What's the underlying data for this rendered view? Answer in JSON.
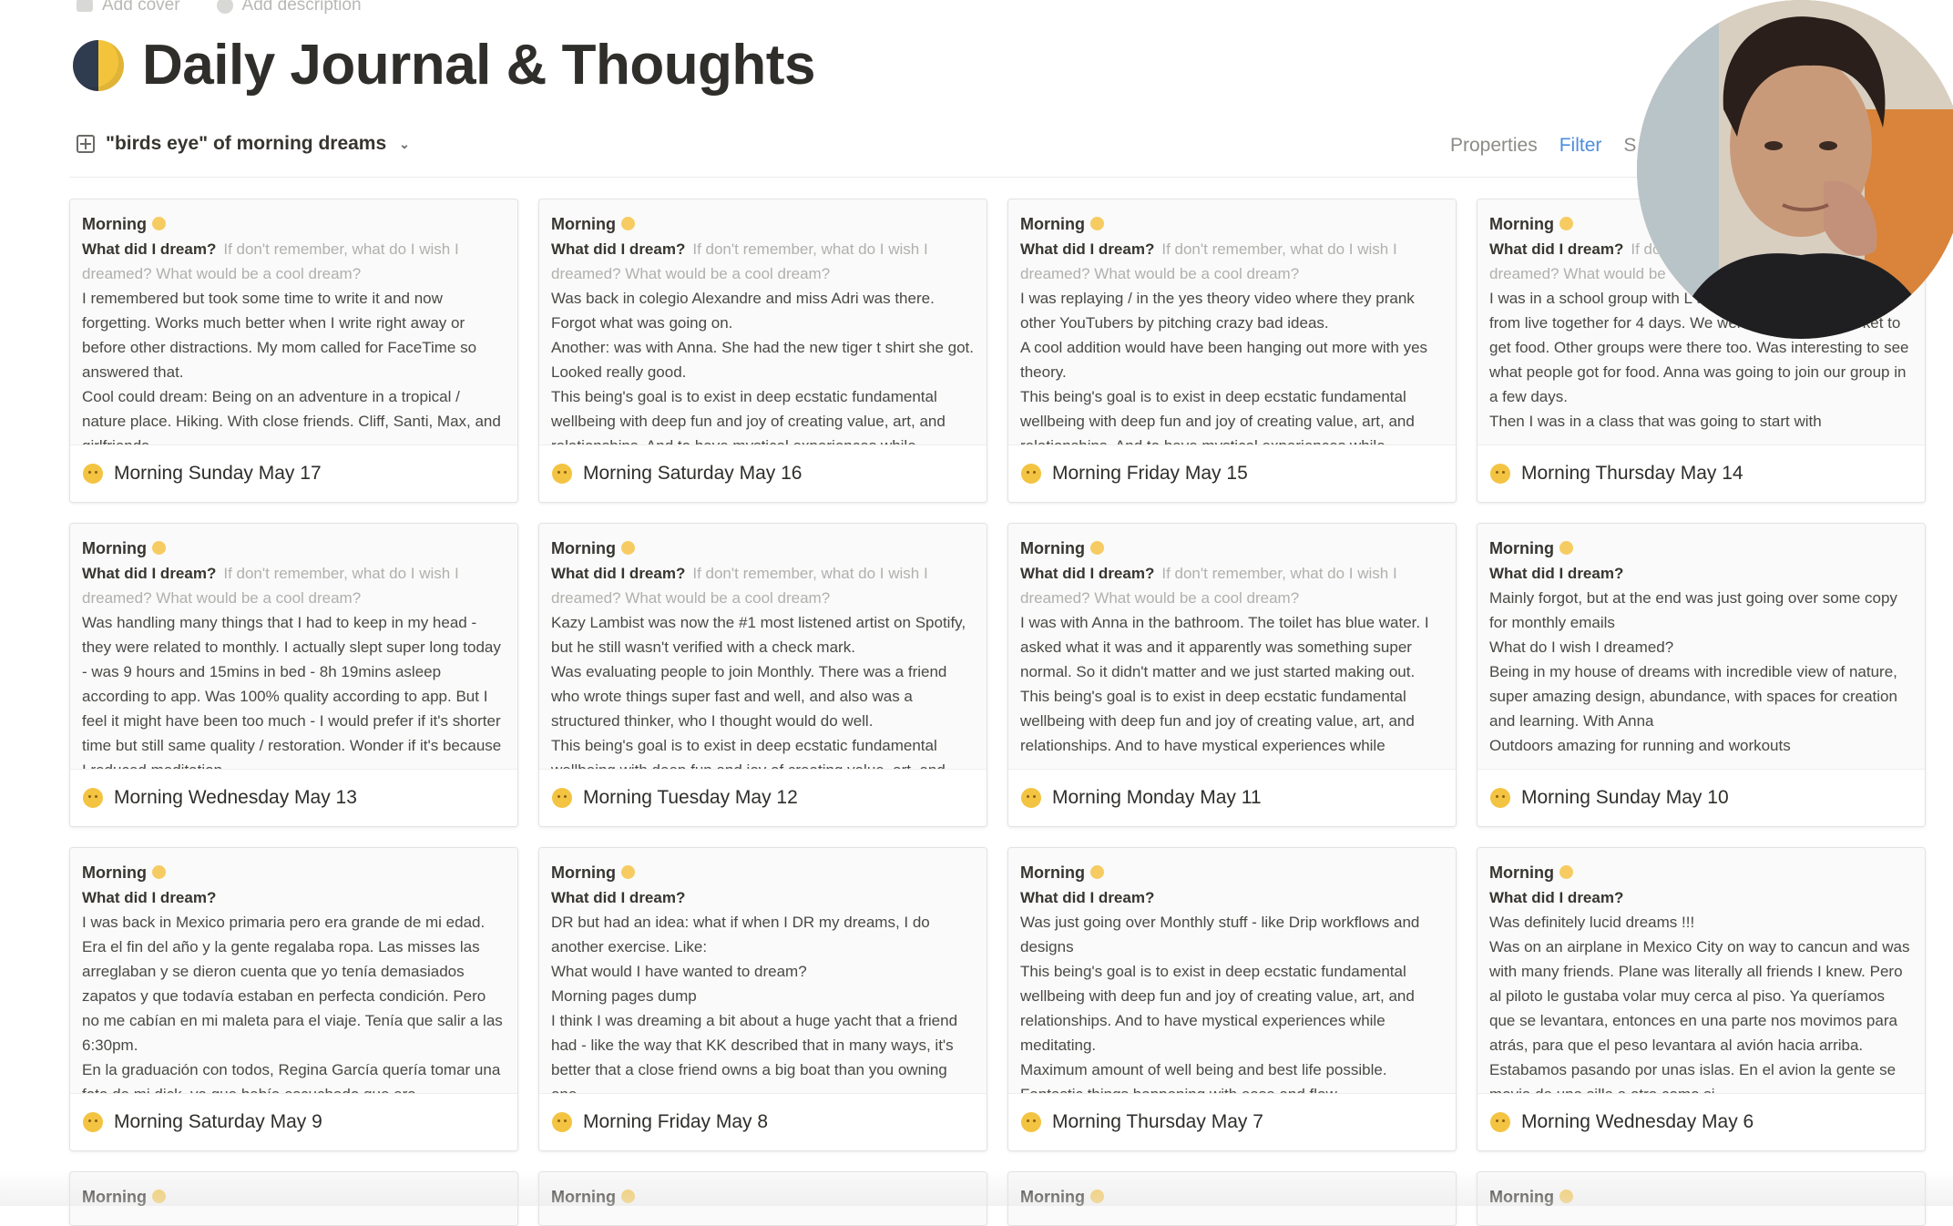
{
  "top_meta": {
    "add_cover": "Add cover",
    "add_description": "Add description"
  },
  "page": {
    "title": "Daily Journal & Thoughts"
  },
  "view": {
    "name": "\"birds eye\" of morning dreams",
    "properties_label": "Properties",
    "filter_label": "Filter",
    "sort_label": "S"
  },
  "cards": [
    {
      "head": "Morning",
      "q_label": "What did I dream?",
      "q_placeholder": "If don't remember, what do I wish I dreamed? What would be a cool dream?",
      "body": "I remembered but took some time to write it and now forgetting. Works much better when I write right away or before other distractions. My mom called for FaceTime so answered that.\nCool could dream: Being on an adventure in a tropical / nature place. Hiking. With close friends. Cliff, Santi, Max, and girlfriends.",
      "title": "Morning Sunday May 17"
    },
    {
      "head": "Morning",
      "q_label": "What did I dream?",
      "q_placeholder": "If don't remember, what do I wish I dreamed? What would be a cool dream?",
      "body": "Was back in colegio Alexandre and miss Adri was there. Forgot what was going on.\nAnother: was with Anna. She had the new tiger t shirt she got. Looked really good.\nThis being's goal is to exist in deep ecstatic fundamental wellbeing with deep fun and joy of creating value, art, and relationships. And to have mystical experiences while",
      "title": "Morning Saturday May 16"
    },
    {
      "head": "Morning",
      "q_label": "What did I dream?",
      "q_placeholder": "If don't remember, what do I wish I dreamed? What would be a cool dream?",
      "body": "I was replaying / in the yes theory video where they prank other YouTubers by pitching crazy bad ideas.\nA cool addition would have been hanging out more with yes theory.\nThis being's goal is to exist in deep ecstatic fundamental wellbeing with deep fun and joy of creating value, art, and relationships. And to have mystical experiences while",
      "title": "Morning Friday May 15"
    },
    {
      "head": "Morning",
      "q_label": "What did I dream?",
      "q_placeholder": "If don't remember, what do I wish I dreamed? What would be",
      "body": "I was in a school group with L teacher hosting us was Hanne from live together for 4 days. We went to the supermarket to get food. Other groups were there too. Was interesting to see what people got for food. Anna was going to join our group in a few days.\nThen I was in a class that was going to start with",
      "title": "Morning Thursday May 14"
    },
    {
      "head": "Morning",
      "q_label": "What did I dream?",
      "q_placeholder": "If don't remember, what do I wish I dreamed? What would be a cool dream?",
      "body": "Was handling many things that I had to keep in my head - they were related to monthly. I actually slept super long today - was 9 hours and 15mins in bed - 8h 19mins asleep according to app. Was 100% quality according to app. But I feel it might have been too much - I would prefer if it's shorter time but still same quality / restoration. Wonder if it's because I reduced meditation",
      "title": "Morning Wednesday May 13"
    },
    {
      "head": "Morning",
      "q_label": "What did I dream?",
      "q_placeholder": "If don't remember, what do I wish I dreamed? What would be a cool dream?",
      "body": "Kazy Lambist was now the #1 most listened artist on Spotify, but he still wasn't verified with a check mark.\nWas evaluating people to join Monthly. There was a friend who wrote things super fast and well, and also was a structured thinker, who I thought would do well.\nThis being's goal is to exist in deep ecstatic fundamental wellbeing with deep fun and joy of creating value, art, and",
      "title": "Morning Tuesday May 12"
    },
    {
      "head": "Morning",
      "q_label": "What did I dream?",
      "q_placeholder": "If don't remember, what do I wish I dreamed? What would be a cool dream?",
      "body": "I was with Anna in the bathroom. The toilet has blue water. I asked what it was and it apparently was something super normal. So it didn't matter and we just started making out.\nThis being's goal is to exist in deep ecstatic fundamental wellbeing with deep fun and joy of creating value, art, and relationships. And to have mystical experiences while",
      "title": "Morning Monday May 11"
    },
    {
      "head": "Morning",
      "q_label": "What did I dream?",
      "q_placeholder": "",
      "body": "Mainly forgot, but at the end was just going over some copy for monthly emails\nWhat do I wish I dreamed?\nBeing in my house of dreams with incredible view of nature, super amazing design, abundance, with spaces for creation and learning. With Anna\nOutdoors amazing for running and workouts",
      "title": "Morning Sunday May 10"
    },
    {
      "head": "Morning",
      "q_label": "What did I dream?",
      "q_placeholder": "",
      "body": "I was back in Mexico primaria pero era grande de mi edad. Era el fin del año y la gente regalaba ropa. Las misses las arreglaban y se dieron cuenta que yo tenía demasiados zapatos y que todavía estaban en perfecta condición. Pero no me cabían en mi maleta para el viaje. Tenía que salir a las 6:30pm.\nEn la graduación con todos, Regina García quería tomar una foto de mi dick, ya que había escuchado que era",
      "title": "Morning Saturday May 9"
    },
    {
      "head": "Morning",
      "q_label": "What did I dream?",
      "q_placeholder": "",
      "body": "DR but had an idea: what if when I DR my dreams, I do another exercise. Like:\nWhat would I have wanted to dream?\nMorning pages dump\nI think I was dreaming a bit about a huge yacht that a friend had - like the way that KK described that in many ways, it's better that a close friend owns a big boat than you owning one",
      "title": "Morning Friday May 8"
    },
    {
      "head": "Morning",
      "q_label": "What did I dream?",
      "q_placeholder": "",
      "body": "Was just going over Monthly stuff - like Drip workflows and designs\nThis being's goal is to exist in deep ecstatic fundamental wellbeing with deep fun and joy of creating value, art, and relationships. And to have mystical experiences while meditating.\nMaximum amount of well being and best life possible.\nFantastic things happening with ease and flow",
      "title": "Morning Thursday May 7"
    },
    {
      "head": "Morning",
      "q_label": "What did I dream?",
      "q_placeholder": "",
      "body": "Was definitely lucid dreams !!!\nWas on an airplane in Mexico City on way to cancun and was with many friends. Plane was literally all friends I knew. Pero al piloto le gustaba volar muy cerca al piso. Ya queríamos que se levantara, entonces en una parte nos movimos para atrás, para que el peso levantara al avión hacia arriba. Estabamos pasando por unas islas. En el avion la gente se movia de una silla a otra como si",
      "title": "Morning Wednesday May 6"
    }
  ],
  "partial_cards": [
    {
      "head": "Morning"
    },
    {
      "head": "Morning"
    },
    {
      "head": "Morning"
    },
    {
      "head": "Morning"
    }
  ]
}
